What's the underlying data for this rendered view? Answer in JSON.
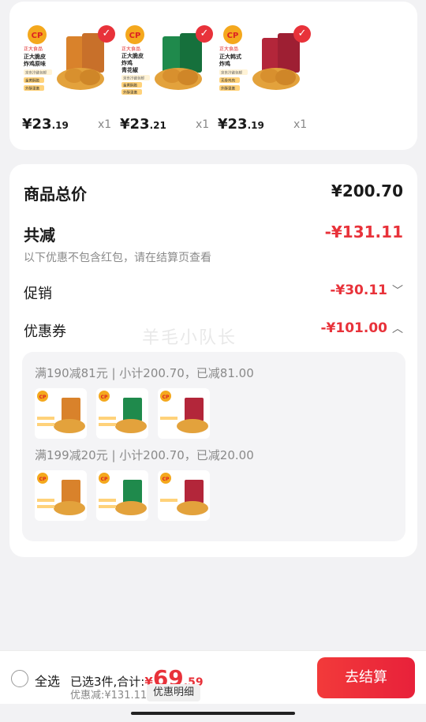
{
  "products": [
    {
      "brand": "正大食品",
      "name1": "正大脆皮",
      "name2": "炸鸡原味",
      "tag1": "京东冷链包邮",
      "tag2": "金黄酥脆",
      "tag3": "外酥里嫩",
      "price_int": "¥23",
      "price_dec": ".19",
      "qty": "x1",
      "pack_color": "#d9822b"
    },
    {
      "brand": "正大食品",
      "name1": "正大脆皮",
      "name2": "炸鸡",
      "name3": "青花椒",
      "tag1": "京东冷链包邮",
      "tag2": "金黄酥脆",
      "tag3": "外酥里嫩",
      "price_int": "¥23",
      "price_dec": ".21",
      "qty": "x1",
      "pack_color": "#1f8a4c"
    },
    {
      "brand": "正大食品",
      "name1": "正大韩式",
      "name2": "炸鸡",
      "tag1": "京东冷链包邮",
      "tag2": "无骨鸡肉",
      "tag3": "外酥里嫩",
      "price_int": "¥23",
      "price_dec": ".19",
      "qty": "x1",
      "pack_color": "#b3263a"
    }
  ],
  "summary": {
    "total_label": "商品总价",
    "total_value": "¥200.70",
    "reduce_label": "共减",
    "reduce_value": "-¥131.11",
    "reduce_note": "以下优惠不包含红包，请在结算页查看",
    "promo_label": "促销",
    "promo_value": "-¥30.11",
    "coupon_label": "优惠券",
    "coupon_value": "-¥101.00"
  },
  "coupons": [
    {
      "line": "满190减81元 | 小计200.70，已减81.00"
    },
    {
      "line": "满199减20元 | 小计200.70，已减20.00"
    }
  ],
  "watermark": "羊毛小队长",
  "bottom": {
    "select_all": "全选",
    "selected_text": "已选3件,合计:",
    "yen": "¥",
    "total_int": "69",
    "total_dec": ".59",
    "discount_text": "优惠减:¥131.11",
    "detail_btn": "优惠明细",
    "checkout": "去结算"
  },
  "colors": {
    "accent": "#e8323a"
  }
}
